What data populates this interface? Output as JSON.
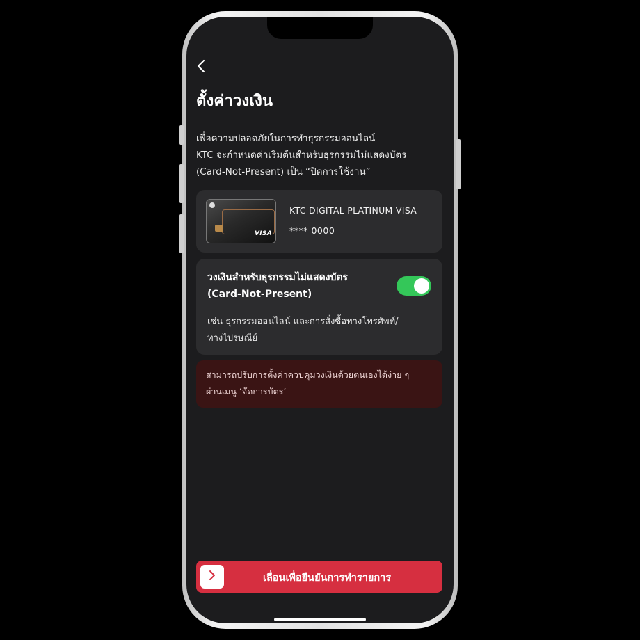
{
  "screen": {
    "title": "ตั้งค่าวงเงิน",
    "intro_lines": [
      "เพื่อความปลอดภัยในการทำธุรกรรมออนไลน์",
      "KTC จะกำหนดค่าเริ่มต้นสำหรับธุรกรรมไม่แสดงบัตร",
      "(Card-Not-Present) เป็น “ปิดการใช้งาน”"
    ]
  },
  "card": {
    "name": "KTC DIGITAL PLATINUM VISA",
    "number": "**** 0000",
    "brand": "VISA"
  },
  "limit": {
    "title_lines": [
      "วงเงินสำหรับธุรกรรมไม่แสดงบัตร",
      "(Card-Not-Present)"
    ],
    "toggle_on": true,
    "desc_lines": [
      "เช่น ธุรกรรมออนไลน์ และการสั่งซื้อทางโทรศัพท์/",
      "ทางไปรษณีย์"
    ]
  },
  "notice": {
    "lines": [
      "สามารถปรับการตั้งค่าควบคุมวงเงินด้วยตนเองได้ง่าย ๆ",
      "ผ่านเมนู ‘จัดการบัตร’"
    ]
  },
  "action": {
    "slide_label": "เลื่อนเพื่อยืนยันการทำรายการ"
  },
  "colors": {
    "background": "#1c1c1e",
    "panel": "#2c2c2e",
    "toggle_on": "#34c759",
    "notice_bg": "#3a1414",
    "accent_red": "#d62f40"
  },
  "icons": {
    "back": "chevron-left-icon",
    "slide": "chevron-right-icon"
  }
}
